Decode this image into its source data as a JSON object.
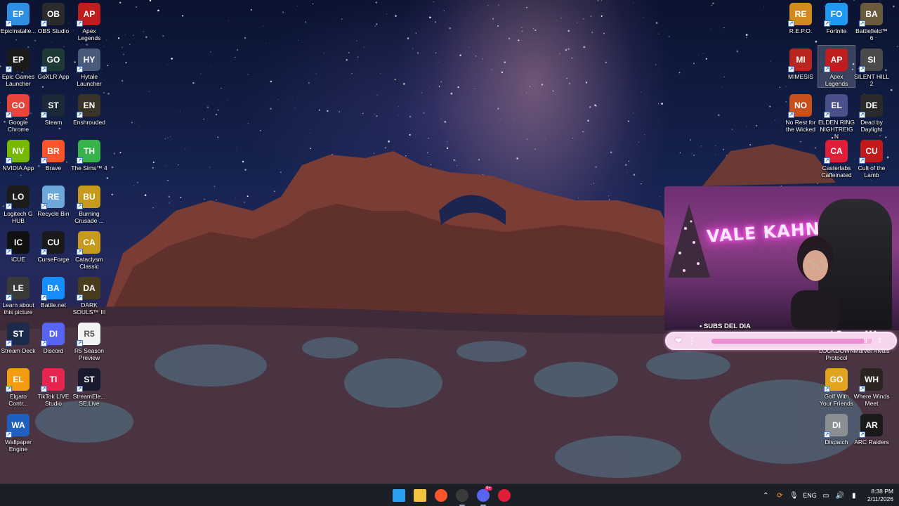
{
  "desktop": {
    "left_icons": [
      {
        "label": "EpicInstalle...",
        "icon": "installer-disc-icon",
        "color": "#2f8fe0"
      },
      {
        "label": "OBS Studio",
        "icon": "obs-icon",
        "color": "#2b2b2b"
      },
      {
        "label": "Apex Legends",
        "icon": "apex-icon",
        "color": "#c01e1e"
      },
      {
        "label": "Epic Games Launcher",
        "icon": "epic-games-icon",
        "color": "#1a1a1a"
      },
      {
        "label": "GoXLR App",
        "icon": "goxlr-icon",
        "color": "#1f3a34"
      },
      {
        "label": "Hytale Launcher",
        "icon": "hytale-icon",
        "color": "#4a5a7a"
      },
      {
        "label": "Google Chrome",
        "icon": "chrome-icon",
        "color": "#e8453c"
      },
      {
        "label": "Steam",
        "icon": "steam-icon",
        "color": "#1b2838"
      },
      {
        "label": "Enshrouded",
        "icon": "enshrouded-icon",
        "color": "#3a3328"
      },
      {
        "label": "NVIDIA App",
        "icon": "nvidia-icon",
        "color": "#76b900"
      },
      {
        "label": "Brave",
        "icon": "brave-icon",
        "color": "#fb542b"
      },
      {
        "label": "The Sims™ 4",
        "icon": "sims-icon",
        "color": "#37b34a"
      },
      {
        "label": "Logitech G HUB",
        "icon": "logitech-icon",
        "color": "#1c1c1c"
      },
      {
        "label": "Recycle Bin",
        "icon": "recycle-bin-icon",
        "color": "#6ea8d8"
      },
      {
        "label": "Burning Crusade ...",
        "icon": "wow-icon",
        "color": "#c79a1c"
      },
      {
        "label": "iCUE",
        "icon": "icue-icon",
        "color": "#111111"
      },
      {
        "label": "CurseForge",
        "icon": "curseforge-icon",
        "color": "#1a1a1a"
      },
      {
        "label": "Cataclysm Classic",
        "icon": "wow-cataclysm-icon",
        "color": "#c79a1c"
      },
      {
        "label": "Learn about this picture",
        "icon": "learn-picture-icon",
        "color": "#3a3a3a"
      },
      {
        "label": "Battle.net",
        "icon": "battlenet-icon",
        "color": "#148eff"
      },
      {
        "label": "DARK SOULS™ III",
        "icon": "dark-souls-icon",
        "color": "#4a3d1e"
      },
      {
        "label": "Stream Deck",
        "icon": "stream-deck-icon",
        "color": "#1e2a4a"
      },
      {
        "label": "Discord",
        "icon": "discord-icon",
        "color": "#5865f2"
      },
      {
        "label": "R5 Season Preview",
        "icon": "document-icon",
        "color": "#f2f2f2"
      },
      {
        "label": "Elgato Contr...",
        "icon": "elgato-icon",
        "color": "#f39c12"
      },
      {
        "label": "TikTok LIVE Studio",
        "icon": "tiktok-icon",
        "color": "#e4254f"
      },
      {
        "label": "StreamEle... SE.Live",
        "icon": "streamelements-icon",
        "color": "#1a1a2e"
      },
      {
        "label": "Wallpaper Engine",
        "icon": "wallpaper-engine-icon",
        "color": "#1f5fbf"
      }
    ],
    "right_icons": [
      {
        "label": "R.E.P.O.",
        "icon": "repo-icon",
        "color": "#d38a1f"
      },
      {
        "label": "Fortnite",
        "icon": "fortnite-icon",
        "color": "#1f9af2"
      },
      {
        "label": "Battlefield™ 6",
        "icon": "battlefield-icon",
        "color": "#6b5a3c"
      },
      {
        "label": "MIMESIS",
        "icon": "mimesis-icon",
        "color": "#b8261f"
      },
      {
        "label": "Apex Legends",
        "icon": "apex-icon",
        "color": "#c01e1e"
      },
      {
        "label": "SILENT HILL 2",
        "icon": "silent-hill-icon",
        "color": "#4a4a4a"
      },
      {
        "label": "No Rest for the Wicked",
        "icon": "no-rest-icon",
        "color": "#c8501c"
      },
      {
        "label": "ELDEN RING NIGHTREIGN",
        "icon": "elden-ring-icon",
        "color": "#4b4f8a"
      },
      {
        "label": "Dead by Daylight",
        "icon": "dead-by-daylight-icon",
        "color": "#2a2a2a"
      },
      {
        "label": "Casterlabs Caffeinated",
        "icon": "casterlabs-icon",
        "color": "#e01e37"
      },
      {
        "label": "Cult of the Lamb",
        "icon": "cult-lamb-icon",
        "color": "#c21a1a"
      },
      {
        "label": "LOCKDOWN Protocol",
        "icon": "lockdown-icon",
        "color": "#333333"
      },
      {
        "label": "Marvel Rivals",
        "icon": "marvel-rivals-icon",
        "color": "#333333"
      },
      {
        "label": "Golf With Your Friends",
        "icon": "golf-icon",
        "color": "#e2a41e"
      },
      {
        "label": "Where Winds Meet",
        "icon": "where-winds-icon",
        "color": "#2b2420"
      },
      {
        "label": "Dispatch",
        "icon": "dispatch-icon",
        "color": "#8a8f94"
      },
      {
        "label": "ARC Raiders",
        "icon": "arc-raiders-icon",
        "color": "#1a1a1a"
      }
    ]
  },
  "overlay": {
    "neon_sign": "VALE KAHN",
    "subs_label": "SUBS DEL DIA",
    "goal_count": "9 / 7",
    "goal_fraction": 0.95
  },
  "taskbar": {
    "apps": [
      {
        "name": "start",
        "icon": "windows-start-icon",
        "color": "#2aa0f0"
      },
      {
        "name": "file-explorer",
        "icon": "folder-icon",
        "color": "#f2c53d"
      },
      {
        "name": "brave",
        "icon": "brave-icon",
        "color": "#fb542b"
      },
      {
        "name": "obs",
        "icon": "obs-icon",
        "color": "#3a3a3a"
      },
      {
        "name": "discord",
        "icon": "discord-icon",
        "color": "#5865f2",
        "badge": "9+"
      },
      {
        "name": "casterlabs",
        "icon": "casterlabs-icon",
        "color": "#e01e37"
      }
    ],
    "tray": {
      "language": "ENG",
      "time": "8:38 PM",
      "date": "2/11/2026"
    }
  }
}
